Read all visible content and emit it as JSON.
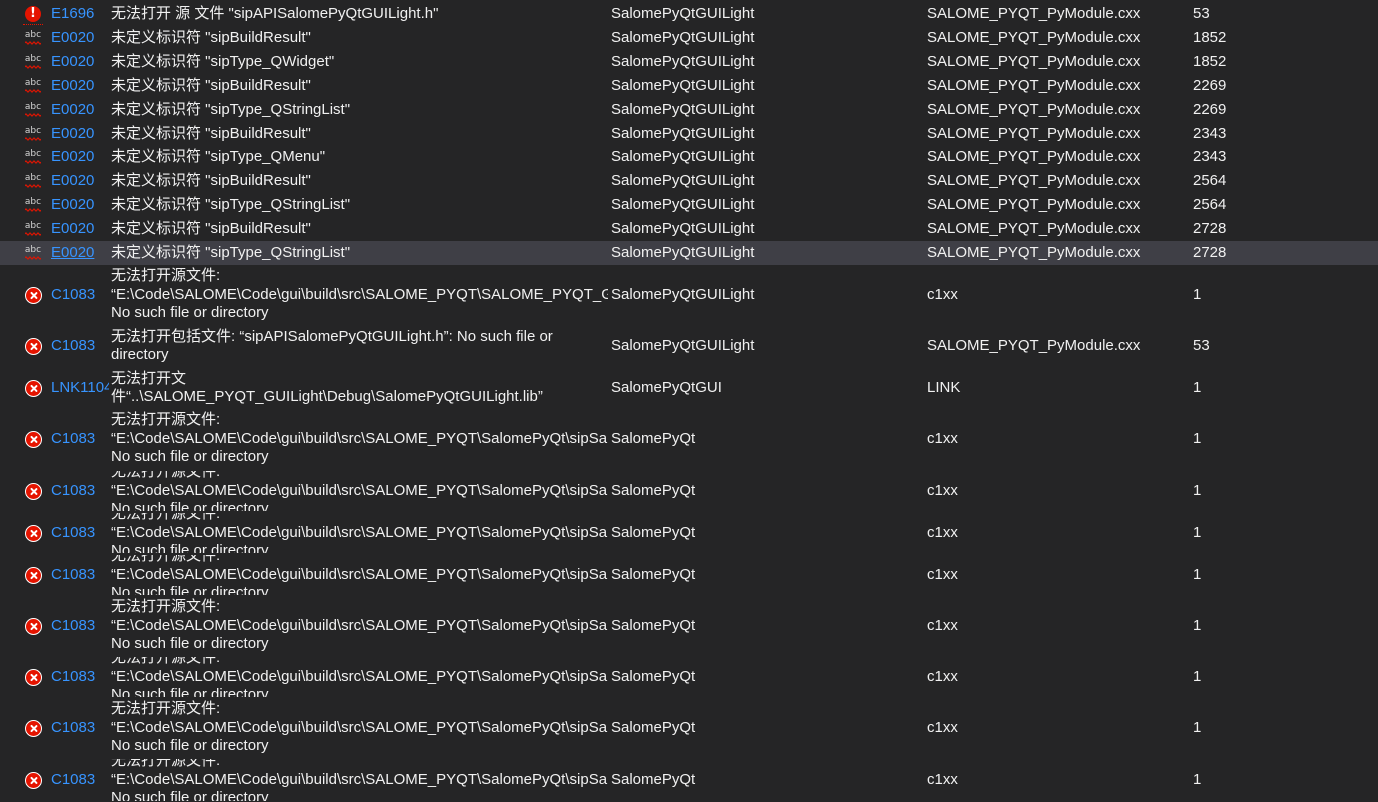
{
  "colors": {
    "background": "#252526",
    "selected_row": "#3f3f46",
    "code_link": "#3794ff",
    "error_red": "#e51400",
    "text": "#f1f1f1"
  },
  "rows": [
    {
      "icon": "squiggle-error-icon",
      "code": "E1696",
      "description": "无法打开 源 文件 \"sipAPISalomePyQtGUILight.h\"",
      "project": "SalomePyQtGUILight",
      "file": "SALOME_PYQT_PyModule.cxx",
      "line": "53"
    },
    {
      "icon": "spellcheck-icon",
      "code": "E0020",
      "description": "未定义标识符 \"sipBuildResult\"",
      "project": "SalomePyQtGUILight",
      "file": "SALOME_PYQT_PyModule.cxx",
      "line": "1852"
    },
    {
      "icon": "spellcheck-icon",
      "code": "E0020",
      "description": "未定义标识符 \"sipType_QWidget\"",
      "project": "SalomePyQtGUILight",
      "file": "SALOME_PYQT_PyModule.cxx",
      "line": "1852"
    },
    {
      "icon": "spellcheck-icon",
      "code": "E0020",
      "description": "未定义标识符 \"sipBuildResult\"",
      "project": "SalomePyQtGUILight",
      "file": "SALOME_PYQT_PyModule.cxx",
      "line": "2269"
    },
    {
      "icon": "spellcheck-icon",
      "code": "E0020",
      "description": "未定义标识符 \"sipType_QStringList\"",
      "project": "SalomePyQtGUILight",
      "file": "SALOME_PYQT_PyModule.cxx",
      "line": "2269"
    },
    {
      "icon": "spellcheck-icon",
      "code": "E0020",
      "description": "未定义标识符 \"sipBuildResult\"",
      "project": "SalomePyQtGUILight",
      "file": "SALOME_PYQT_PyModule.cxx",
      "line": "2343"
    },
    {
      "icon": "spellcheck-icon",
      "code": "E0020",
      "description": "未定义标识符 \"sipType_QMenu\"",
      "project": "SalomePyQtGUILight",
      "file": "SALOME_PYQT_PyModule.cxx",
      "line": "2343"
    },
    {
      "icon": "spellcheck-icon",
      "code": "E0020",
      "description": "未定义标识符 \"sipBuildResult\"",
      "project": "SalomePyQtGUILight",
      "file": "SALOME_PYQT_PyModule.cxx",
      "line": "2564"
    },
    {
      "icon": "spellcheck-icon",
      "code": "E0020",
      "description": "未定义标识符 \"sipType_QStringList\"",
      "project": "SalomePyQtGUILight",
      "file": "SALOME_PYQT_PyModule.cxx",
      "line": "2564"
    },
    {
      "icon": "spellcheck-icon",
      "code": "E0020",
      "description": "未定义标识符 \"sipBuildResult\"",
      "project": "SalomePyQtGUILight",
      "file": "SALOME_PYQT_PyModule.cxx",
      "line": "2728"
    },
    {
      "icon": "spellcheck-icon",
      "code": "E0020",
      "description": "未定义标识符 \"sipType_QStringList\"",
      "project": "SalomePyQtGUILight",
      "file": "SALOME_PYQT_PyModule.cxx",
      "line": "2728",
      "selected": true
    },
    {
      "icon": "error-icon",
      "code": "C1083",
      "description": "无法打开源文件: “E:\\Code\\SALOME\\Code\\gui\\build\\src\\SALOME_PYQT\\SALOME_PYQT_GUILight\\sipSalomePyQtGUILightcmodule.cc”: No such file or directory",
      "project": "SalomePyQtGUILight",
      "file": "c1xx",
      "line": "1"
    },
    {
      "icon": "error-icon",
      "code": "C1083",
      "description": "无法打开包括文件: “sipAPISalomePyQtGUILight.h”: No such file or directory",
      "project": "SalomePyQtGUILight",
      "file": "SALOME_PYQT_PyModule.cxx",
      "line": "53"
    },
    {
      "icon": "error-icon",
      "code": "LNK1104",
      "description": "无法打开文件“..\\SALOME_PYQT_GUILight\\Debug\\SalomePyQtGUILight.lib”",
      "project": "SalomePyQtGUI",
      "file": "LINK",
      "line": "1"
    },
    {
      "icon": "error-icon",
      "code": "C1083",
      "description": "无法打开源文件: “E:\\Code\\SALOME\\Code\\gui\\build\\src\\SALOME_PYQT\\SalomePyQt\\sipSalomePyQtSALOME_Selection.cc”: No such file or directory",
      "project": "SalomePyQt",
      "file": "c1xx",
      "line": "1"
    },
    {
      "icon": "error-icon",
      "code": "C1083",
      "description": "无法打开源文件: “E:\\Code\\SALOME\\Code\\gui\\build\\src\\SALOME_PYQT\\SalomePyQt\\sipSalomePyQtcmodule.cc”: No such file or directory",
      "project": "SalomePyQt",
      "file": "c1xx",
      "line": "1"
    },
    {
      "icon": "error-icon",
      "code": "C1083",
      "description": "无法打开源文件: “E:\\Code\\SALOME\\Code\\gui\\build\\src\\SALOME_PYQT\\SalomePyQt\\sipSalomePyQtQtxAction.cc”: No such file or directory",
      "project": "SalomePyQt",
      "file": "c1xx",
      "line": "1"
    },
    {
      "icon": "error-icon",
      "code": "C1083",
      "description": "无法打开源文件: “E:\\Code\\SALOME\\Code\\gui\\build\\src\\SALOME_PYQT\\SalomePyQt\\sipSalomePyQtQtxActionSet.cc”: No such file or directory",
      "project": "SalomePyQt",
      "file": "c1xx",
      "line": "1"
    },
    {
      "icon": "error-icon",
      "code": "C1083",
      "description": "无法打开源文件: “E:\\Code\\SALOME\\Code\\gui\\build\\src\\SALOME_PYQT\\SalomePyQt\\sipSalomePyQtQtxActionGroup.cc”: No such file or directory",
      "project": "SalomePyQt",
      "file": "c1xx",
      "line": "1"
    },
    {
      "icon": "error-icon",
      "code": "C1083",
      "description": "无法打开源文件: “E:\\Code\\SALOME\\Code\\gui\\build\\src\\SALOME_PYQT\\SalomePyQt\\sipSalomePyQtQtxTreeView.cc”: No such file or directory",
      "project": "SalomePyQt",
      "file": "c1xx",
      "line": "1"
    },
    {
      "icon": "error-icon",
      "code": "C1083",
      "description": "无法打开源文件: “E:\\Code\\SALOME\\Code\\gui\\build\\src\\SALOME_PYQT\\SalomePyQt\\sipSalomePyQtUserDefinedContent.cc”: No such file or directory",
      "project": "SalomePyQt",
      "file": "c1xx",
      "line": "1"
    },
    {
      "icon": "error-icon",
      "code": "C1083",
      "description": "无法打开源文件: “E:\\Code\\SALOME\\Code\\gui\\build\\src\\SALOME_PYQT\\SalomePyQt\\sipSalomePyQtSalomePyQt.cc”: No such file or directory",
      "project": "SalomePyQt",
      "file": "c1xx",
      "line": "1"
    }
  ]
}
